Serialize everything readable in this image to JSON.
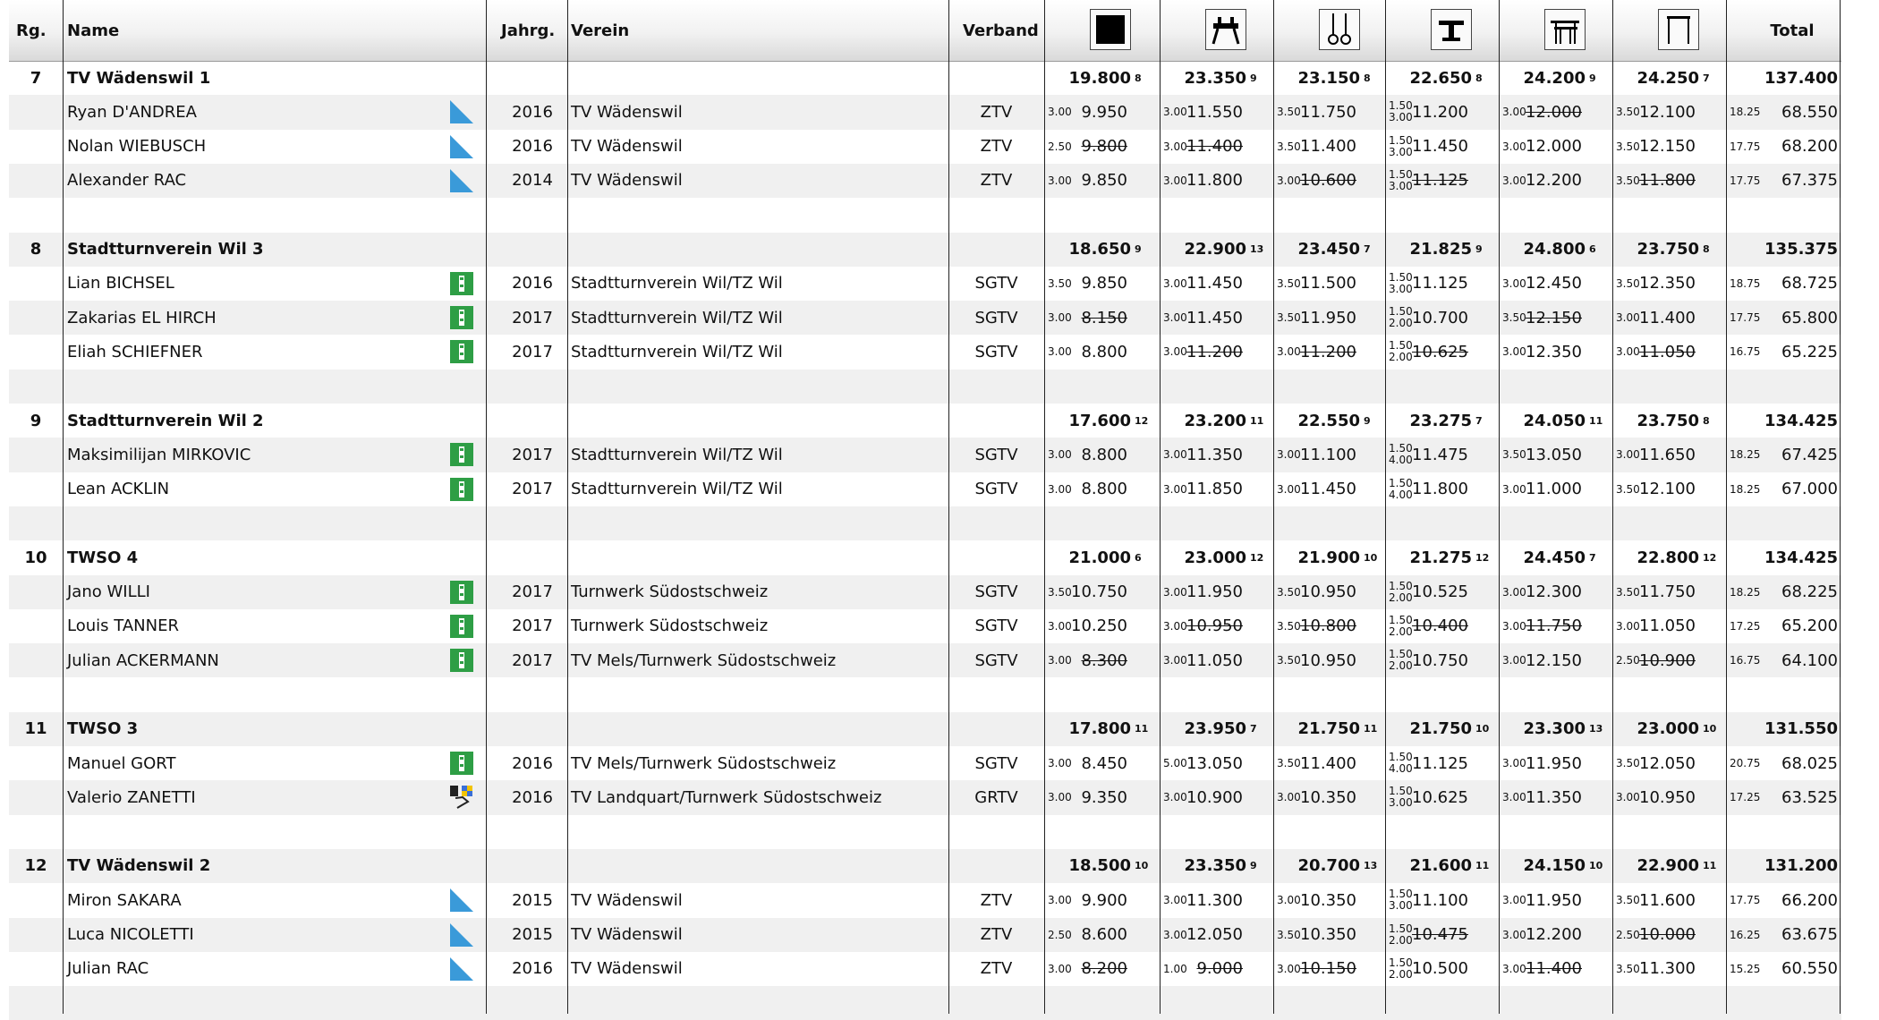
{
  "header": {
    "rank": "Rg.",
    "name": "Name",
    "year": "Jahrg.",
    "club": "Verein",
    "association": "Verband",
    "total": "Total",
    "apparatus_icons": [
      "floor-icon",
      "pommel-horse-icon",
      "rings-icon",
      "vault-icon",
      "parallel-bars-icon",
      "high-bar-icon"
    ]
  },
  "colors": {
    "header_gradient_top": "#ffffff",
    "header_gradient_bottom": "#d9d9d9",
    "alt_row": "#f0f0f0",
    "zuerich_flag": "#3a9ad9",
    "stgallen_flag": "#2e9e45"
  },
  "teams": [
    {
      "rank": "7",
      "name": "TV Wädenswil 1",
      "scores": [
        {
          "v": "19.800",
          "r": "8"
        },
        {
          "v": "23.350",
          "r": "9"
        },
        {
          "v": "23.150",
          "r": "8"
        },
        {
          "v": "22.650",
          "r": "8"
        },
        {
          "v": "24.200",
          "r": "9"
        },
        {
          "v": "24.250",
          "r": "7"
        }
      ],
      "total": "137.400",
      "members": [
        {
          "name": "Ryan D'ANDREA",
          "flag": "zh",
          "year": "2016",
          "club": "TV Wädenswil",
          "assoc": "ZTV",
          "total_d": "18.25",
          "total": "68.550",
          "app": [
            {
              "d": "3.00",
              "v": "9.950"
            },
            {
              "d": "3.00",
              "v": "11.550"
            },
            {
              "d": "3.50",
              "v": "11.750"
            },
            {
              "d": "1.50",
              "d2": "3.00",
              "v": "11.200"
            },
            {
              "d": "3.00",
              "v": "12.000",
              "s": true
            },
            {
              "d": "3.50",
              "v": "12.100"
            }
          ]
        },
        {
          "name": "Nolan WIEBUSCH",
          "flag": "zh",
          "year": "2016",
          "club": "TV Wädenswil",
          "assoc": "ZTV",
          "total_d": "17.75",
          "total": "68.200",
          "app": [
            {
              "d": "2.50",
              "v": "9.800",
              "s": true
            },
            {
              "d": "3.00",
              "v": "11.400",
              "s": true
            },
            {
              "d": "3.50",
              "v": "11.400"
            },
            {
              "d": "1.50",
              "d2": "3.00",
              "v": "11.450"
            },
            {
              "d": "3.00",
              "v": "12.000"
            },
            {
              "d": "3.50",
              "v": "12.150"
            }
          ]
        },
        {
          "name": "Alexander RAC",
          "flag": "zh",
          "year": "2014",
          "club": "TV Wädenswil",
          "assoc": "ZTV",
          "total_d": "17.75",
          "total": "67.375",
          "app": [
            {
              "d": "3.00",
              "v": "9.850"
            },
            {
              "d": "3.00",
              "v": "11.800"
            },
            {
              "d": "3.00",
              "v": "10.600",
              "s": true
            },
            {
              "d": "1.50",
              "d2": "3.00",
              "v": "11.125",
              "s": true
            },
            {
              "d": "3.00",
              "v": "12.200"
            },
            {
              "d": "3.50",
              "v": "11.800",
              "s": true
            }
          ]
        }
      ]
    },
    {
      "rank": "8",
      "name": "Stadtturnverein Wil 3",
      "scores": [
        {
          "v": "18.650",
          "r": "9"
        },
        {
          "v": "22.900",
          "r": "13"
        },
        {
          "v": "23.450",
          "r": "7"
        },
        {
          "v": "21.825",
          "r": "9"
        },
        {
          "v": "24.800",
          "r": "6"
        },
        {
          "v": "23.750",
          "r": "8"
        }
      ],
      "total": "135.375",
      "members": [
        {
          "name": "Lian BICHSEL",
          "flag": "sg",
          "year": "2016",
          "club": "Stadtturnverein Wil/TZ Wil",
          "assoc": "SGTV",
          "total_d": "18.75",
          "total": "68.725",
          "app": [
            {
              "d": "3.50",
              "v": "9.850"
            },
            {
              "d": "3.00",
              "v": "11.450"
            },
            {
              "d": "3.50",
              "v": "11.500"
            },
            {
              "d": "1.50",
              "d2": "3.00",
              "v": "11.125"
            },
            {
              "d": "3.00",
              "v": "12.450"
            },
            {
              "d": "3.50",
              "v": "12.350"
            }
          ]
        },
        {
          "name": "Zakarias EL HIRCH",
          "flag": "sg",
          "year": "2017",
          "club": "Stadtturnverein Wil/TZ Wil",
          "assoc": "SGTV",
          "total_d": "17.75",
          "total": "65.800",
          "app": [
            {
              "d": "3.00",
              "v": "8.150",
              "s": true
            },
            {
              "d": "3.00",
              "v": "11.450"
            },
            {
              "d": "3.50",
              "v": "11.950"
            },
            {
              "d": "1.50",
              "d2": "2.00",
              "v": "10.700"
            },
            {
              "d": "3.50",
              "v": "12.150",
              "s": true
            },
            {
              "d": "3.00",
              "v": "11.400"
            }
          ]
        },
        {
          "name": "Eliah SCHIEFNER",
          "flag": "sg",
          "year": "2017",
          "club": "Stadtturnverein Wil/TZ Wil",
          "assoc": "SGTV",
          "total_d": "16.75",
          "total": "65.225",
          "app": [
            {
              "d": "3.00",
              "v": "8.800"
            },
            {
              "d": "3.00",
              "v": "11.200",
              "s": true
            },
            {
              "d": "3.00",
              "v": "11.200",
              "s": true
            },
            {
              "d": "1.50",
              "d2": "2.00",
              "v": "10.625",
              "s": true
            },
            {
              "d": "3.00",
              "v": "12.350"
            },
            {
              "d": "3.00",
              "v": "11.050",
              "s": true
            }
          ]
        }
      ]
    },
    {
      "rank": "9",
      "name": "Stadtturnverein Wil 2",
      "scores": [
        {
          "v": "17.600",
          "r": "12"
        },
        {
          "v": "23.200",
          "r": "11"
        },
        {
          "v": "22.550",
          "r": "9"
        },
        {
          "v": "23.275",
          "r": "7"
        },
        {
          "v": "24.050",
          "r": "11"
        },
        {
          "v": "23.750",
          "r": "8"
        }
      ],
      "total": "134.425",
      "members": [
        {
          "name": "Maksimilijan MIRKOVIC",
          "flag": "sg",
          "year": "2017",
          "club": "Stadtturnverein Wil/TZ Wil",
          "assoc": "SGTV",
          "total_d": "18.25",
          "total": "67.425",
          "app": [
            {
              "d": "3.00",
              "v": "8.800"
            },
            {
              "d": "3.00",
              "v": "11.350"
            },
            {
              "d": "3.00",
              "v": "11.100"
            },
            {
              "d": "1.50",
              "d2": "4.00",
              "v": "11.475"
            },
            {
              "d": "3.50",
              "v": "13.050"
            },
            {
              "d": "3.00",
              "v": "11.650"
            }
          ]
        },
        {
          "name": "Lean ACKLIN",
          "flag": "sg",
          "year": "2017",
          "club": "Stadtturnverein Wil/TZ Wil",
          "assoc": "SGTV",
          "total_d": "18.25",
          "total": "67.000",
          "app": [
            {
              "d": "3.00",
              "v": "8.800"
            },
            {
              "d": "3.00",
              "v": "11.850"
            },
            {
              "d": "3.00",
              "v": "11.450"
            },
            {
              "d": "1.50",
              "d2": "4.00",
              "v": "11.800"
            },
            {
              "d": "3.00",
              "v": "11.000"
            },
            {
              "d": "3.50",
              "v": "12.100"
            }
          ]
        }
      ]
    },
    {
      "rank": "10",
      "name": "TWSO 4",
      "scores": [
        {
          "v": "21.000",
          "r": "6"
        },
        {
          "v": "23.000",
          "r": "12"
        },
        {
          "v": "21.900",
          "r": "10"
        },
        {
          "v": "21.275",
          "r": "12"
        },
        {
          "v": "24.450",
          "r": "7"
        },
        {
          "v": "22.800",
          "r": "12"
        }
      ],
      "total": "134.425",
      "members": [
        {
          "name": "Jano WILLI",
          "flag": "sg",
          "year": "2017",
          "club": "Turnwerk Südostschweiz",
          "assoc": "SGTV",
          "total_d": "18.25",
          "total": "68.225",
          "app": [
            {
              "d": "3.50",
              "v": "10.750"
            },
            {
              "d": "3.00",
              "v": "11.950"
            },
            {
              "d": "3.50",
              "v": "10.950"
            },
            {
              "d": "1.50",
              "d2": "2.00",
              "v": "10.525"
            },
            {
              "d": "3.00",
              "v": "12.300"
            },
            {
              "d": "3.50",
              "v": "11.750"
            }
          ]
        },
        {
          "name": "Louis TANNER",
          "flag": "sg",
          "year": "2017",
          "club": "Turnwerk Südostschweiz",
          "assoc": "SGTV",
          "total_d": "17.25",
          "total": "65.200",
          "app": [
            {
              "d": "3.00",
              "v": "10.250"
            },
            {
              "d": "3.00",
              "v": "10.950",
              "s": true
            },
            {
              "d": "3.50",
              "v": "10.800",
              "s": true
            },
            {
              "d": "1.50",
              "d2": "2.00",
              "v": "10.400",
              "s": true
            },
            {
              "d": "3.00",
              "v": "11.750",
              "s": true
            },
            {
              "d": "3.00",
              "v": "11.050"
            }
          ]
        },
        {
          "name": "Julian ACKERMANN",
          "flag": "sg",
          "year": "2017",
          "club": "TV Mels/Turnwerk Südostschweiz",
          "assoc": "SGTV",
          "total_d": "16.75",
          "total": "64.100",
          "app": [
            {
              "d": "3.00",
              "v": "8.300",
              "s": true
            },
            {
              "d": "3.00",
              "v": "11.050"
            },
            {
              "d": "3.50",
              "v": "10.950"
            },
            {
              "d": "1.50",
              "d2": "2.00",
              "v": "10.750"
            },
            {
              "d": "3.00",
              "v": "12.150"
            },
            {
              "d": "2.50",
              "v": "10.900",
              "s": true
            }
          ]
        }
      ]
    },
    {
      "rank": "11",
      "name": "TWSO 3",
      "scores": [
        {
          "v": "17.800",
          "r": "11"
        },
        {
          "v": "23.950",
          "r": "7"
        },
        {
          "v": "21.750",
          "r": "11"
        },
        {
          "v": "21.750",
          "r": "10"
        },
        {
          "v": "23.300",
          "r": "13"
        },
        {
          "v": "23.000",
          "r": "10"
        }
      ],
      "total": "131.550",
      "members": [
        {
          "name": "Manuel GORT",
          "flag": "sg",
          "year": "2016",
          "club": "TV Mels/Turnwerk Südostschweiz",
          "assoc": "SGTV",
          "total_d": "20.75",
          "total": "68.025",
          "app": [
            {
              "d": "3.00",
              "v": "8.450"
            },
            {
              "d": "5.00",
              "v": "13.050"
            },
            {
              "d": "3.50",
              "v": "11.400"
            },
            {
              "d": "1.50",
              "d2": "4.00",
              "v": "11.125"
            },
            {
              "d": "3.00",
              "v": "11.950"
            },
            {
              "d": "3.50",
              "v": "12.050"
            }
          ]
        },
        {
          "name": "Valerio ZANETTI",
          "flag": "gr",
          "year": "2016",
          "club": "TV Landquart/Turnwerk Südostschweiz",
          "assoc": "GRTV",
          "total_d": "17.25",
          "total": "63.525",
          "app": [
            {
              "d": "3.00",
              "v": "9.350"
            },
            {
              "d": "3.00",
              "v": "10.900"
            },
            {
              "d": "3.00",
              "v": "10.350"
            },
            {
              "d": "1.50",
              "d2": "3.00",
              "v": "10.625"
            },
            {
              "d": "3.00",
              "v": "11.350"
            },
            {
              "d": "3.00",
              "v": "10.950"
            }
          ]
        }
      ]
    },
    {
      "rank": "12",
      "name": "TV Wädenswil 2",
      "scores": [
        {
          "v": "18.500",
          "r": "10"
        },
        {
          "v": "23.350",
          "r": "9"
        },
        {
          "v": "20.700",
          "r": "13"
        },
        {
          "v": "21.600",
          "r": "11"
        },
        {
          "v": "24.150",
          "r": "10"
        },
        {
          "v": "22.900",
          "r": "11"
        }
      ],
      "total": "131.200",
      "members": [
        {
          "name": "Miron SAKARA",
          "flag": "zh",
          "year": "2015",
          "club": "TV Wädenswil",
          "assoc": "ZTV",
          "total_d": "17.75",
          "total": "66.200",
          "app": [
            {
              "d": "3.00",
              "v": "9.900"
            },
            {
              "d": "3.00",
              "v": "11.300"
            },
            {
              "d": "3.00",
              "v": "10.350"
            },
            {
              "d": "1.50",
              "d2": "3.00",
              "v": "11.100"
            },
            {
              "d": "3.00",
              "v": "11.950"
            },
            {
              "d": "3.50",
              "v": "11.600"
            }
          ]
        },
        {
          "name": "Luca NICOLETTI",
          "flag": "zh",
          "year": "2015",
          "club": "TV Wädenswil",
          "assoc": "ZTV",
          "total_d": "16.25",
          "total": "63.675",
          "app": [
            {
              "d": "2.50",
              "v": "8.600"
            },
            {
              "d": "3.00",
              "v": "12.050"
            },
            {
              "d": "3.50",
              "v": "10.350"
            },
            {
              "d": "1.50",
              "d2": "2.00",
              "v": "10.475",
              "s": true
            },
            {
              "d": "3.00",
              "v": "12.200"
            },
            {
              "d": "2.50",
              "v": "10.000",
              "s": true
            }
          ]
        },
        {
          "name": "Julian RAC",
          "flag": "zh",
          "year": "2016",
          "club": "TV Wädenswil",
          "assoc": "ZTV",
          "total_d": "15.25",
          "total": "60.550",
          "app": [
            {
              "d": "3.00",
              "v": "8.200",
              "s": true
            },
            {
              "d": "1.00",
              "v": "9.000",
              "s": true
            },
            {
              "d": "3.00",
              "v": "10.150",
              "s": true
            },
            {
              "d": "1.50",
              "d2": "2.00",
              "v": "10.500"
            },
            {
              "d": "3.00",
              "v": "11.400",
              "s": true
            },
            {
              "d": "3.50",
              "v": "11.300"
            }
          ]
        }
      ]
    }
  ]
}
